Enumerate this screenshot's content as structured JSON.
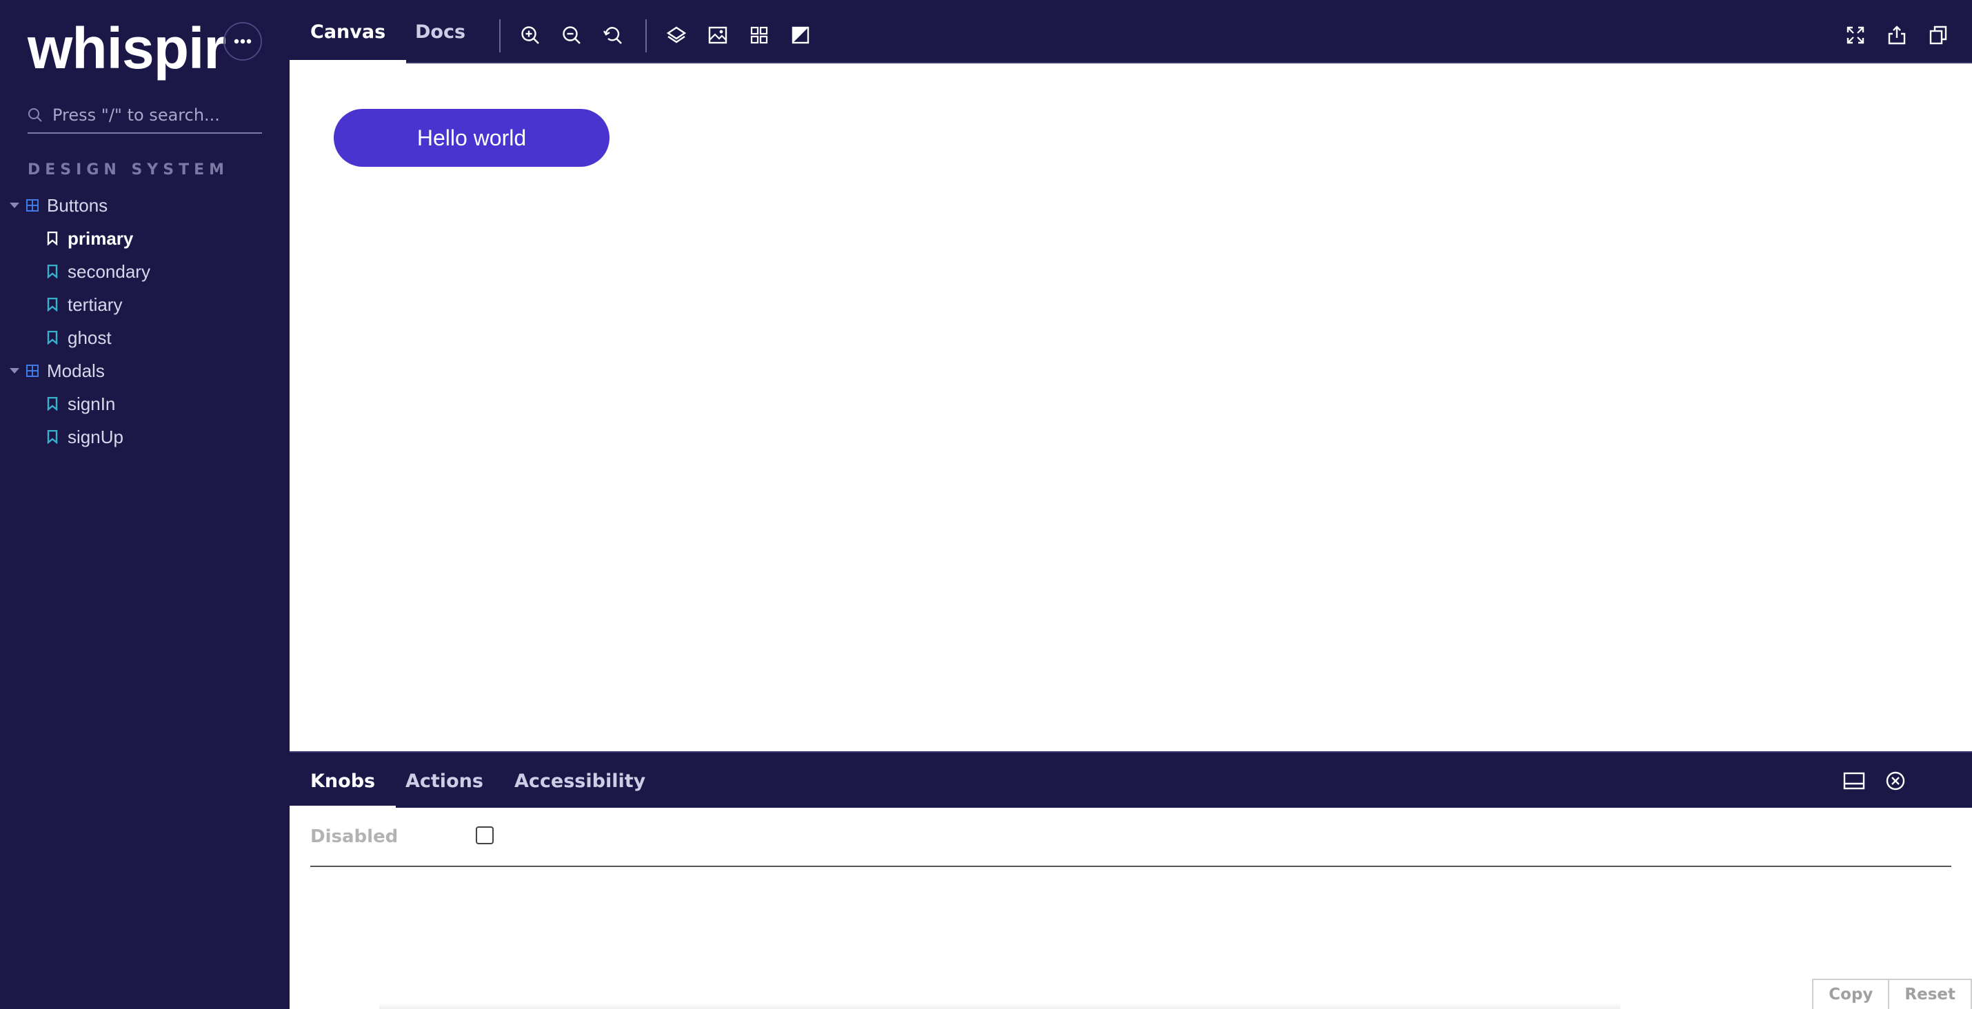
{
  "sidebar": {
    "logo": "whispir",
    "search_placeholder": "Press \"/\" to search...",
    "section_title": "DESIGN SYSTEM",
    "groups": [
      {
        "label": "Buttons",
        "stories": [
          "primary",
          "secondary",
          "tertiary",
          "ghost"
        ]
      },
      {
        "label": "Modals",
        "stories": [
          "signIn",
          "signUp"
        ]
      }
    ],
    "active_story": "primary"
  },
  "toolbar": {
    "tabs": [
      {
        "label": "Canvas",
        "active": true
      },
      {
        "label": "Docs",
        "active": false
      }
    ],
    "tools": [
      "zoom-in-icon",
      "zoom-out-icon",
      "reset-zoom-icon",
      "background-icon",
      "image-icon",
      "grid-icon",
      "contrast-icon"
    ],
    "right_tools": [
      "fullscreen-icon",
      "share-icon",
      "copy-link-icon"
    ]
  },
  "canvas": {
    "button_label": "Hello world",
    "button_color": "#4a34d0"
  },
  "panel": {
    "tabs": [
      {
        "label": "Knobs",
        "active": true
      },
      {
        "label": "Actions",
        "active": false
      },
      {
        "label": "Accessibility",
        "active": false
      }
    ],
    "knobs": [
      {
        "label": "Disabled",
        "checked": false
      }
    ],
    "copy_label": "Copy",
    "reset_label": "Reset"
  },
  "colors": {
    "chrome": "#1b1747",
    "accent": "#4a34d0",
    "icon_blue": "#3f7be6"
  }
}
